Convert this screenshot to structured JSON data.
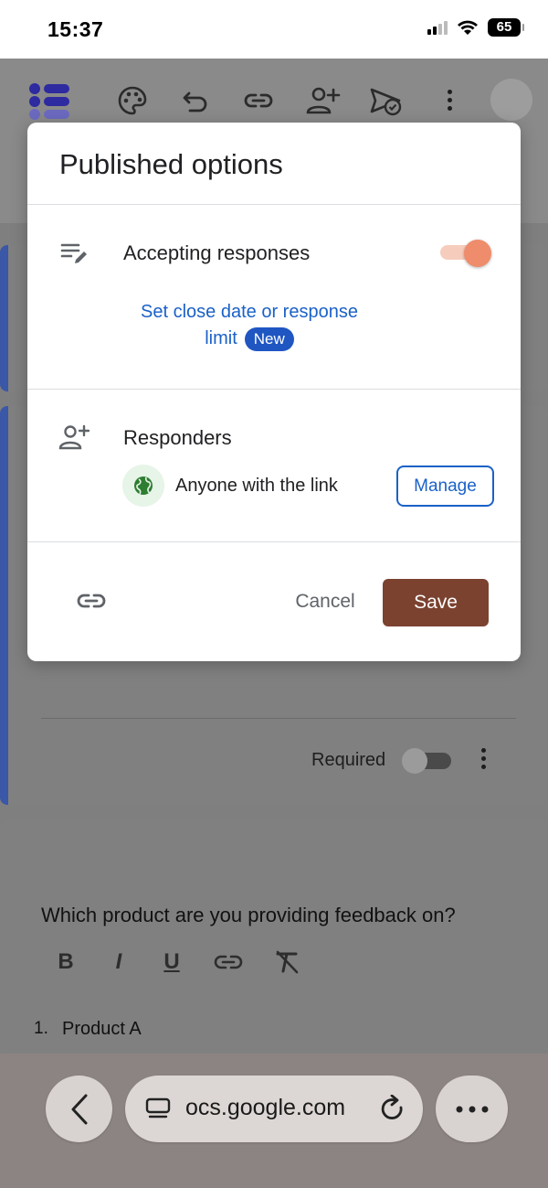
{
  "status_bar": {
    "time": "15:37",
    "battery": "65",
    "icons": [
      "cellular-signal-icon",
      "wifi-icon",
      "battery-icon"
    ]
  },
  "toolbar": {
    "icons": [
      "google-forms-logo-icon",
      "palette-icon",
      "undo-icon",
      "link-icon",
      "add-collaborator-icon",
      "publish-icon",
      "more-vert-icon",
      "avatar"
    ]
  },
  "dialog": {
    "title": "Published options",
    "accepting_label": "Accepting responses",
    "accepting_on": true,
    "close_date_link": "Set close date or response",
    "close_date_link_2": "limit",
    "new_badge": "New",
    "responders_label": "Responders",
    "access_text": "Anyone with the link",
    "manage_label": "Manage",
    "cancel_label": "Cancel",
    "save_label": "Save",
    "colors": {
      "accent_blue": "#1a61c8",
      "save_button": "#7b4230",
      "toggle_knob": "#ef8c6b"
    }
  },
  "background_form": {
    "required_label": "Required",
    "question": "Which product are you providing feedback on?",
    "format_tools": [
      "B",
      "I",
      "U"
    ],
    "option_number": "1.",
    "option_text": "Product A"
  },
  "browser": {
    "url": "ocs.google.com"
  }
}
